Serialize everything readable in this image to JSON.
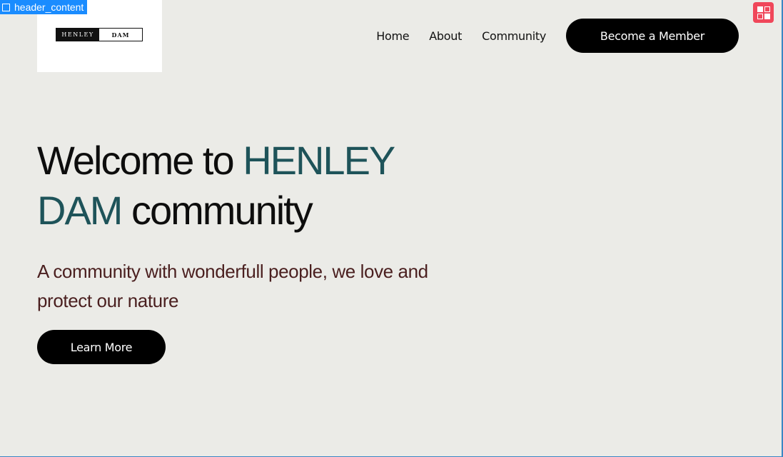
{
  "dev_overlay": {
    "label": "header_content"
  },
  "logo": {
    "left_text": "HENLEY",
    "right_text": "DAM"
  },
  "nav": {
    "items": [
      {
        "label": "Home"
      },
      {
        "label": "About"
      },
      {
        "label": "Community"
      }
    ],
    "cta_label": "Become a Member"
  },
  "hero": {
    "title_part1": "Welcome to ",
    "title_accent1": "HENLEY",
    "title_accent2": "DAM",
    "title_part2": " community",
    "subtitle": "A community with wonderfull people, we love and protect our nature",
    "button_label": "Learn More"
  },
  "colors": {
    "background": "#ebebe7",
    "accent": "#1e5359",
    "subtitle": "#4a1f1f",
    "button": "#000000",
    "editor_badge": "#f0475a"
  },
  "icons": {
    "dev_tag_icon": "square-outline-icon",
    "editor_icon": "layout-edit-icon"
  }
}
